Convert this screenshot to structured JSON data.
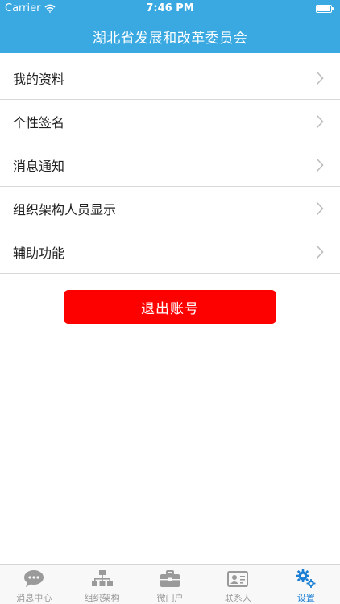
{
  "statusbar": {
    "carrier": "Carrier",
    "time": "7:46 PM"
  },
  "header": {
    "title": "湖北省发展和改革委员会"
  },
  "menu": {
    "items": [
      {
        "label": "我的资料"
      },
      {
        "label": "个性签名"
      },
      {
        "label": "消息通知"
      },
      {
        "label": "组织架构人员显示"
      },
      {
        "label": "辅助功能"
      }
    ]
  },
  "logout": {
    "label": "退出账号"
  },
  "tabbar": {
    "items": [
      {
        "label": "消息中心",
        "icon": "chat-bubble-icon"
      },
      {
        "label": "组织架构",
        "icon": "org-chart-icon"
      },
      {
        "label": "微门户",
        "icon": "briefcase-icon"
      },
      {
        "label": "联系人",
        "icon": "contact-card-icon"
      },
      {
        "label": "设置",
        "icon": "gears-icon",
        "active": true
      }
    ]
  },
  "colors": {
    "header": "#3aa9e2",
    "logout": "#fd0000",
    "active_tab": "#1a7fd4",
    "inactive_tab": "#999999"
  }
}
